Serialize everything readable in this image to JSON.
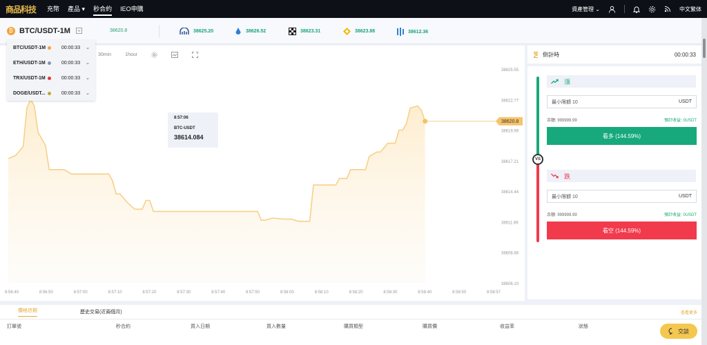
{
  "nav": {
    "logo_text": "商品科技",
    "items": [
      {
        "label": "充幣"
      },
      {
        "label": "產品"
      },
      {
        "label": "秒合約"
      },
      {
        "label": "IEO申購"
      }
    ],
    "asset_menu": "資產管理",
    "language": "中文繁体"
  },
  "ticker": {
    "pair": "BTC/USDT-1M",
    "price": "38620.8",
    "exchanges": [
      {
        "icon": "kraken-icon",
        "price": "38625.20"
      },
      {
        "icon": "drop-icon",
        "price": "38626.52"
      },
      {
        "icon": "okx-icon",
        "price": "38623.31"
      },
      {
        "icon": "binance-icon",
        "price": "38623.88"
      },
      {
        "icon": "bars-icon",
        "price": "38612.36"
      }
    ]
  },
  "dropdown": [
    {
      "pair": "BTC/USDT-1M",
      "color": "#f2a33a",
      "time": "00:00:33"
    },
    {
      "pair": "ETH/USDT-1M",
      "color": "#8a92b2",
      "time": "00:00:33"
    },
    {
      "pair": "TRX/USDT-1M",
      "color": "#e5343a",
      "time": "00:00:33"
    },
    {
      "pair": "DOGE/USDT...",
      "color": "#c2a633",
      "time": "00:00:33"
    }
  ],
  "chart_toolbar": {
    "interval_30": "30min",
    "interval_1h": "1hour"
  },
  "tooltip": {
    "time": "8:57:06",
    "pair": "BTC-USDT",
    "value": "38614.084"
  },
  "chart_data": {
    "type": "area",
    "x_labels": [
      "8:56:40",
      "8:56:50",
      "8:57:00",
      "8:57:10",
      "8:57:20",
      "8:57:30",
      "8:57:40",
      "8:57:50",
      "8:58:00",
      "8:58:10",
      "8:58:20",
      "8:58:30",
      "8:58:40",
      "8:58:50",
      "8:58:57"
    ],
    "y_ticks": [
      "38625.55",
      "38622.77",
      "38619.99",
      "38617.21",
      "38614.44",
      "38611.66",
      "38608.88",
      "38606.10"
    ],
    "ylim": [
      38606.1,
      38625.55
    ],
    "current_price": "38620.8",
    "points": [
      [
        0,
        38617.4
      ],
      [
        2,
        38617.7
      ],
      [
        4,
        38618.5
      ],
      [
        5,
        38622.0
      ],
      [
        6,
        38622.8
      ],
      [
        7,
        38622.2
      ],
      [
        8,
        38619.8
      ],
      [
        10,
        38618.6
      ],
      [
        11,
        38616.4
      ],
      [
        13,
        38616.4
      ],
      [
        15,
        38616.4
      ],
      [
        17,
        38616.0
      ],
      [
        20,
        38616.0
      ],
      [
        22,
        38616.0
      ],
      [
        24,
        38616.0
      ],
      [
        27,
        38616.0
      ],
      [
        28,
        38615.4
      ],
      [
        29,
        38614.2
      ],
      [
        30,
        38614.2
      ],
      [
        32,
        38613.4
      ],
      [
        34,
        38612.8
      ],
      [
        36,
        38612.8
      ],
      [
        37,
        38613.6
      ],
      [
        38,
        38613.6
      ],
      [
        39,
        38612.6
      ],
      [
        40,
        38612.6
      ],
      [
        45,
        38612.6
      ],
      [
        50,
        38612.6
      ],
      [
        55,
        38612.6
      ],
      [
        60,
        38612.6
      ],
      [
        66,
        38612.6
      ],
      [
        67,
        38612.6
      ],
      [
        68,
        38611.8
      ],
      [
        69,
        38611.8
      ],
      [
        71,
        38612.0
      ],
      [
        74,
        38611.9
      ],
      [
        76,
        38611.9
      ],
      [
        78,
        38611.7
      ],
      [
        81,
        38611.7
      ],
      [
        82,
        38615.0
      ],
      [
        84,
        38615.0
      ],
      [
        86,
        38615.0
      ],
      [
        88,
        38615.0
      ],
      [
        89,
        38615.6
      ],
      [
        91,
        38615.6
      ],
      [
        92,
        38616.4
      ],
      [
        94,
        38616.4
      ],
      [
        96,
        38616.4
      ],
      [
        97,
        38617.6
      ],
      [
        99,
        38618.0
      ],
      [
        100,
        38618.0
      ],
      [
        102,
        38618.8
      ],
      [
        104,
        38618.8
      ],
      [
        105,
        38620.0
      ],
      [
        106,
        38620.0
      ],
      [
        107,
        38620.6
      ],
      [
        108,
        38622.0
      ],
      [
        110,
        38622.2
      ],
      [
        111,
        38621.8
      ],
      [
        112,
        38620.8
      ]
    ]
  },
  "right": {
    "countdown_label": "倒計時",
    "countdown": "00:00:33",
    "up_label": "漲",
    "down_label": "跌",
    "min_amount": "最小限額 10",
    "unit": "USDT",
    "balance": "余額: 999999.99",
    "expected": "預計收益: 0USDT",
    "buy_label": "看多 (144.59%)",
    "sell_label": "看空 (144.59%)",
    "vs": "VS",
    "green": "#17a97b",
    "red": "#f13a4c"
  },
  "bottom": {
    "tabs": [
      "價格信期",
      "歷史交易(近兩個月)"
    ],
    "more": "查看更多",
    "columns": [
      "訂單號",
      "秒合約",
      "買入日期",
      "買入數量",
      "購買類型",
      "購買價",
      "收益率",
      "狀態"
    ]
  },
  "chat": {
    "label": "交談"
  }
}
